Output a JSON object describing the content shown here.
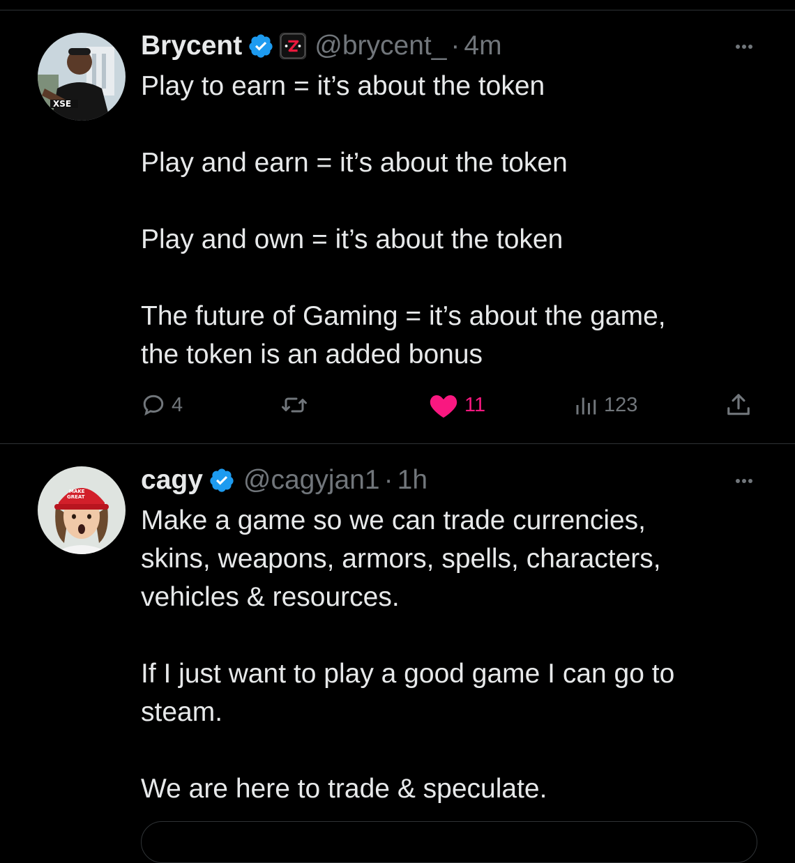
{
  "tweets": [
    {
      "display_name": "Brycent",
      "verified_icon": "verified-badge-icon",
      "affiliate_icon": "affiliate-logo-icon",
      "handle": "@brycent_",
      "separator": "·",
      "time": "4m",
      "paragraphs": [
        "Play to earn = it’s about the token",
        "Play and earn = it’s about the token",
        "Play and own = it’s about the token",
        "The future of Gaming = it’s about the game,\nthe token is an added bonus"
      ],
      "actions": {
        "reply_count": "4",
        "retweet_count": "",
        "like_count": "11",
        "views_count": "123"
      }
    },
    {
      "display_name": "cagy",
      "verified_icon": "verified-badge-icon",
      "handle": "@cagyjan1",
      "separator": "·",
      "time": "1h",
      "paragraphs": [
        "Make a game so we can trade currencies,\nskins, weapons, armors, spells, characters,\nvehicles & resources.",
        "If I just want to play a good game I can go to\nsteam.",
        "We are here to trade & speculate."
      ]
    }
  ],
  "colors": {
    "background": "#000000",
    "text_primary": "#e7e9ea",
    "text_secondary": "#71767b",
    "divider": "#2f3336",
    "verified_blue": "#1d9bf0",
    "like_pink": "#f91880"
  }
}
